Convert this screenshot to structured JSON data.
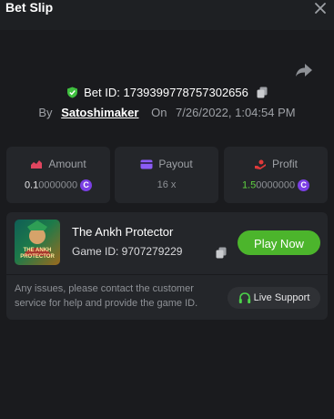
{
  "header": {
    "title": "Bet Slip"
  },
  "bet": {
    "id_label": "Bet ID: 1739399778757302656",
    "by_prefix": "By",
    "user": "Satoshimaker",
    "on_prefix": "On",
    "datetime": "7/26/2022, 1:04:54 PM"
  },
  "stats": {
    "amount": {
      "label": "Amount",
      "value_main": "0.1",
      "value_rest": "0000000",
      "coin": "C"
    },
    "payout": {
      "label": "Payout",
      "value": "16 x"
    },
    "profit": {
      "label": "Profit",
      "value_main": "1.5",
      "value_rest": "0000000",
      "coin": "C"
    }
  },
  "game": {
    "thumb_text": "THE ANKH PROTECTOR",
    "name": "The Ankh Protector",
    "id_label": "Game ID: 9707279229",
    "play_label": "Play Now",
    "support_text": "Any issues, please contact the customer service for help and provide the game ID.",
    "live_support_label": "Live Support"
  },
  "colors": {
    "accent_green": "#4cb52c",
    "coin_purple": "#7b3fe4",
    "amount_icon": "#e0455f",
    "payout_icon": "#8b5cf6",
    "profit_icon": "#e03a3a"
  }
}
